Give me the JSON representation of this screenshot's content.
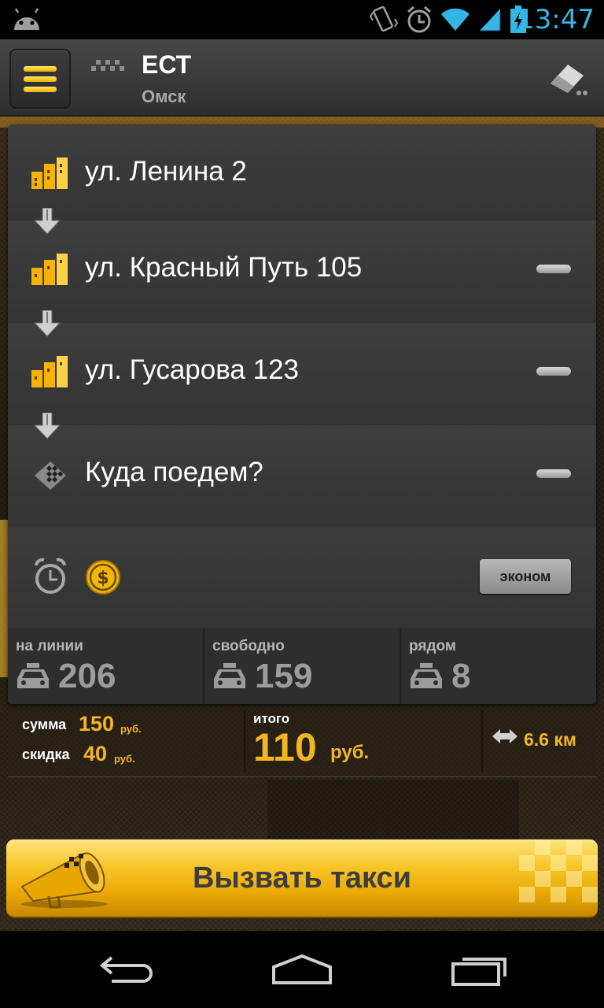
{
  "status_bar": {
    "time": "13:47",
    "icons": [
      "android-icon",
      "vibrate-icon",
      "alarm-icon",
      "wifi-icon",
      "signal-icon",
      "battery-charging-icon"
    ]
  },
  "header": {
    "brand": "ЕСТ",
    "city": "Омск"
  },
  "route": {
    "stops": [
      {
        "label": "ул. Ленина 2",
        "removable": false
      },
      {
        "label": "ул. Красный Путь 105",
        "removable": true
      },
      {
        "label": "ул. Гусарова 123",
        "removable": true
      },
      {
        "label": "Куда поедем?",
        "removable": true
      }
    ]
  },
  "options": {
    "tariff_label": "эконом"
  },
  "stats": [
    {
      "label": "на линии",
      "value": "206"
    },
    {
      "label": "свободно",
      "value": "159"
    },
    {
      "label": "рядом",
      "value": "8"
    }
  ],
  "price": {
    "sum_label": "сумма",
    "sum_value": "150",
    "sum_unit": "руб.",
    "discount_label": "скидка",
    "discount_value": "40",
    "discount_unit": "руб.",
    "total_label": "итого",
    "total_value": "110",
    "total_unit": "руб.",
    "distance": "6.6 км"
  },
  "call_button": {
    "label": "Вызвать такси"
  },
  "colors": {
    "accent": "#f3b620",
    "status_blue": "#33b5e5"
  }
}
